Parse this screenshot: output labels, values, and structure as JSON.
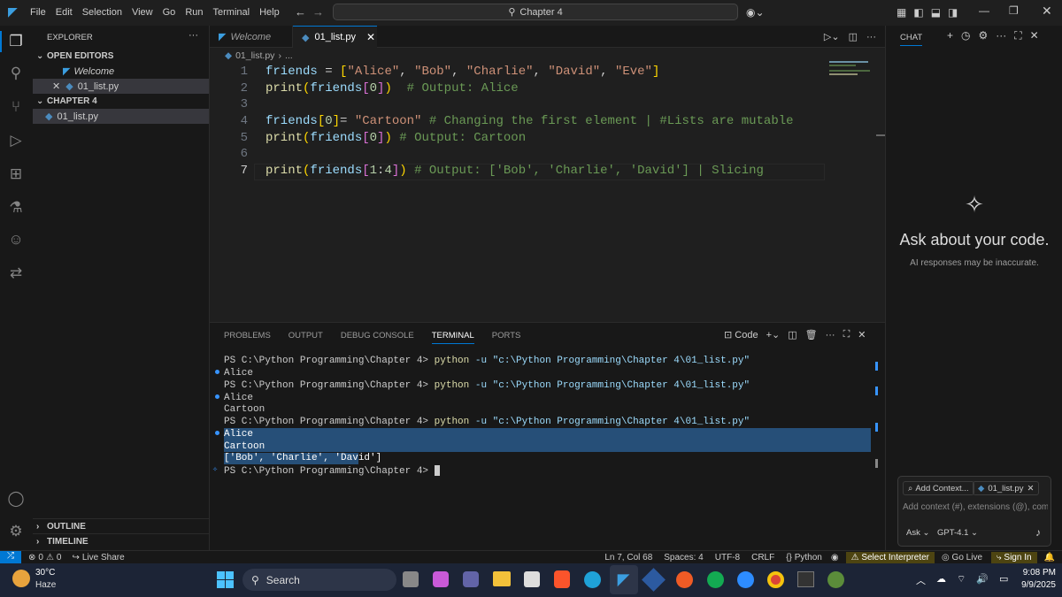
{
  "titlebar": {
    "menu": [
      "File",
      "Edit",
      "Selection",
      "View",
      "Go",
      "Run",
      "Terminal",
      "Help"
    ],
    "search": "Chapter 4"
  },
  "explorer": {
    "title": "EXPLORER",
    "open_editors": "OPEN EDITORS",
    "open_items": [
      "Welcome",
      "01_list.py"
    ],
    "folder": "CHAPTER 4",
    "folder_items": [
      "01_list.py"
    ],
    "outline": "OUTLINE",
    "timeline": "TIMELINE"
  },
  "tabs": [
    "Welcome",
    "01_list.py"
  ],
  "breadcrumb": {
    "file": "01_list.py",
    "more": "..."
  },
  "code_lines": [
    {
      "n": "1",
      "text": "friends = [\"Alice\", \"Bob\", \"Charlie\", \"David\", \"Eve\"]"
    },
    {
      "n": "2",
      "text": "print(friends[0])  # Output: Alice"
    },
    {
      "n": "3",
      "text": ""
    },
    {
      "n": "4",
      "text": "friends[0]= \"Cartoon\" # Changing the first element | #Lists are mutable"
    },
    {
      "n": "5",
      "text": "print(friends[0]) # Output: Cartoon"
    },
    {
      "n": "6",
      "text": ""
    },
    {
      "n": "7",
      "text": "print(friends[1:4]) # Output: ['Bob', 'Charlie', 'David'] | Slicing"
    }
  ],
  "panel": {
    "tabs": [
      "PROBLEMS",
      "OUTPUT",
      "DEBUG CONSOLE",
      "TERMINAL",
      "PORTS"
    ],
    "active": "TERMINAL",
    "shell_label": "Code"
  },
  "terminal": {
    "prompt": "PS C:\\Python Programming\\Chapter 4> ",
    "cmd": "python",
    "args": " -u \"c:\\Python Programming\\Chapter 4\\01_list.py\"",
    "outputs": [
      "Alice",
      "Alice",
      "Cartoon",
      "Alice",
      "Cartoon",
      "['Bob', 'Charlie', 'David']"
    ]
  },
  "chat": {
    "title": "CHAT",
    "heading": "Ask about your code.",
    "subtext": "AI responses may be inaccurate.",
    "add_context": "Add Context...",
    "context_file": "01_list.py",
    "placeholder": "Add context (#), extensions (@), com",
    "mode": "Ask",
    "model": "GPT-4.1"
  },
  "status": {
    "errors": "0",
    "warnings": "0",
    "live_share": "Live Share",
    "position": "Ln 7, Col 68",
    "spaces": "Spaces: 4",
    "encoding": "UTF-8",
    "eol": "CRLF",
    "language": "Python",
    "interpreter": "Select Interpreter",
    "go_live": "Go Live",
    "sign_in": "Sign In"
  },
  "taskbar": {
    "temp": "30°C",
    "weather": "Haze",
    "search": "Search",
    "time": "9:08 PM",
    "date": "9/9/2025"
  },
  "colors": {
    "accent": "#0078d4",
    "interpreter_bg": "#4d4411",
    "selection": "#264f78"
  }
}
